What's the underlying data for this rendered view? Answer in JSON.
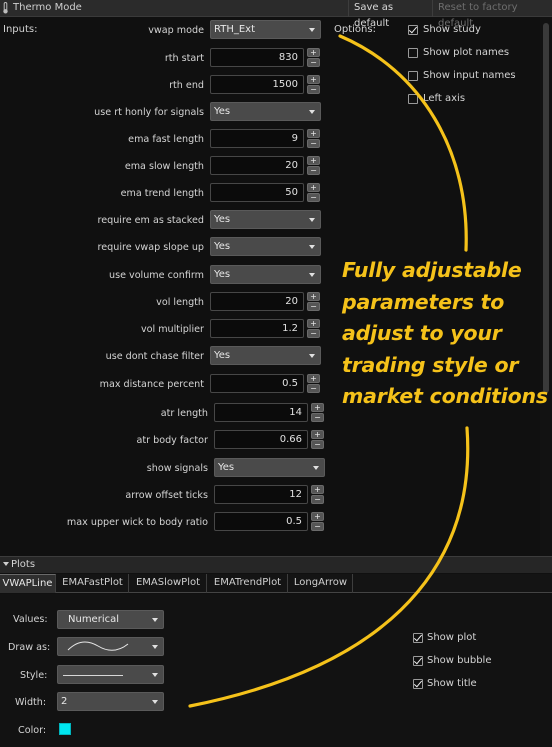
{
  "titlebar": {
    "title": "Thermo Mode",
    "save_label": "Save as default",
    "reset_label": "Reset to factory default"
  },
  "inputs": {
    "label": "Inputs:",
    "rows": [
      {
        "label": "vwap mode",
        "type": "dropdown",
        "value": "RTH_Ext"
      },
      {
        "label": "rth start",
        "type": "number",
        "value": "830"
      },
      {
        "label": "rth end",
        "type": "number",
        "value": "1500"
      },
      {
        "label": "use rt honly for signals",
        "type": "dropdown",
        "value": "Yes"
      },
      {
        "label": "ema fast length",
        "type": "number",
        "value": "9"
      },
      {
        "label": "ema slow length",
        "type": "number",
        "value": "20"
      },
      {
        "label": "ema trend length",
        "type": "number",
        "value": "50"
      },
      {
        "label": "require em as stacked",
        "type": "dropdown",
        "value": "Yes"
      },
      {
        "label": "require vwap slope up",
        "type": "dropdown",
        "value": "Yes"
      },
      {
        "label": "use volume confirm",
        "type": "dropdown",
        "value": "Yes"
      },
      {
        "label": "vol length",
        "type": "number",
        "value": "20"
      },
      {
        "label": "vol multiplier",
        "type": "number",
        "value": "1.2"
      },
      {
        "label": "use dont chase filter",
        "type": "dropdown",
        "value": "Yes"
      },
      {
        "label": "max distance percent",
        "type": "number",
        "value": "0.5"
      },
      {
        "label": "atr length",
        "type": "number",
        "value": "14"
      },
      {
        "label": "atr body factor",
        "type": "number",
        "value": "0.66"
      },
      {
        "label": "show signals",
        "type": "dropdown",
        "value": "Yes"
      },
      {
        "label": "arrow offset ticks",
        "type": "number",
        "value": "12"
      },
      {
        "label": "max upper wick to body ratio",
        "type": "number",
        "value": "0.5"
      }
    ]
  },
  "options": {
    "label": "Options:",
    "items": [
      {
        "label": "Show study",
        "checked": true
      },
      {
        "label": "Show plot names",
        "checked": false
      },
      {
        "label": "Show input names",
        "checked": false
      },
      {
        "label": "Left axis",
        "checked": false
      }
    ]
  },
  "plots": {
    "header": "Plots",
    "tabs": [
      "VWAPLine",
      "EMAFastPlot",
      "EMASlowPlot",
      "EMATrendPlot",
      "LongArrow"
    ],
    "active_tab": "VWAPLine",
    "values_label": "Values:",
    "values_value": "Numerical",
    "draw_as_label": "Draw as:",
    "style_label": "Style:",
    "width_label": "Width:",
    "width_value": "2",
    "color_label": "Color:",
    "color": "#00e5ef",
    "checks": [
      {
        "label": "Show plot",
        "checked": true
      },
      {
        "label": "Show bubble",
        "checked": true
      },
      {
        "label": "Show title",
        "checked": true
      }
    ]
  },
  "annotation": {
    "lines": [
      "Fully adjustable",
      "parameters to",
      "adjust to your",
      "trading style or",
      "market conditions"
    ],
    "color": "#f5c21a"
  }
}
